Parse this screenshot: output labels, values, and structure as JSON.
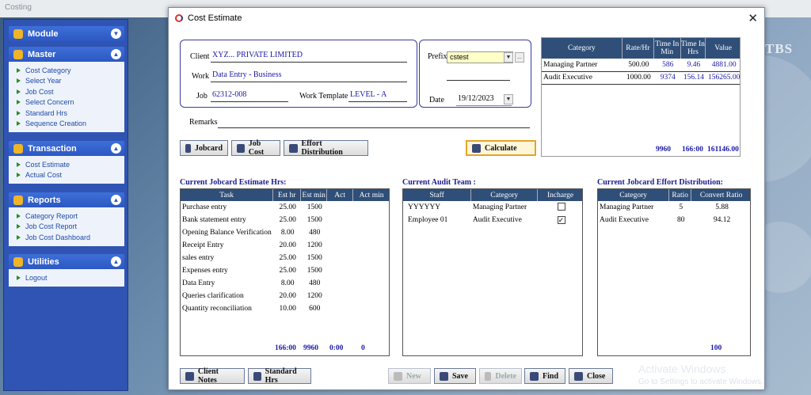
{
  "app": {
    "title": "Costing"
  },
  "sidebar": {
    "panels": [
      {
        "title": "Module",
        "items": []
      },
      {
        "title": "Master",
        "items": [
          "Cost Category",
          "Select Year",
          "Job Cost",
          "Select Concern",
          "Standard Hrs",
          "Sequence Creation"
        ]
      },
      {
        "title": "Transaction",
        "items": [
          "Cost Estimate",
          "Actual Cost"
        ]
      },
      {
        "title": "Reports",
        "items": [
          "Category Report",
          "Job Cost Report",
          "Job Cost Dashboard"
        ]
      },
      {
        "title": "Utilities",
        "items": [
          "Logout"
        ]
      }
    ]
  },
  "background": {
    "logo_text": "TBS"
  },
  "dialog": {
    "title": "Cost Estimate",
    "close_glyph": "✕",
    "form": {
      "client_label": "Client",
      "client_value": "XYZ... PRIVATE LIMITED",
      "work_label": "Work",
      "work_value": "Data Entry - Business",
      "job_label": "Job",
      "job_value": "62312-008",
      "work_template_label": "Work Template",
      "work_template_value": "LEVEL - A",
      "prefix_label": "Prefix",
      "prefix_value": "cstest",
      "date_label": "Date",
      "date_value": "19/12/2023",
      "remarks_label": "Remarks",
      "remarks_value": ""
    },
    "buttons": {
      "jobcard": "Jobcard",
      "job_cost": "Job Cost",
      "effort_distribution": "Effort Distribution",
      "calculate": "Calculate",
      "client_notes": "Client Notes",
      "standard_hrs": "Standard Hrs",
      "new": "New",
      "save": "Save",
      "delete": "Delete",
      "find": "Find",
      "close": "Close"
    },
    "category_table": {
      "headers": [
        "Category",
        "Rate/Hr",
        "Time In Min",
        "Time In Hrs",
        "Value"
      ],
      "rows": [
        [
          "Managing Partner",
          "500.00",
          "586",
          "9.46",
          "4881.00"
        ],
        [
          "Audit Executive",
          "1000.00",
          "9374",
          "156.14",
          "156265.00"
        ]
      ],
      "totals": {
        "min": "9960",
        "hrs": "166:00",
        "value": "161146.00"
      }
    },
    "estimate": {
      "title": "Current Jobcard Estimate Hrs:",
      "headers": [
        "Task",
        "Est hr",
        "Est min",
        "Act",
        "Act min"
      ],
      "rows": [
        [
          "Purchase entry",
          "25.00",
          "1500"
        ],
        [
          "Bank statement entry",
          "25.00",
          "1500"
        ],
        [
          "Opening Balance Verification",
          "8.00",
          "480"
        ],
        [
          "Receipt Entry",
          "20.00",
          "1200"
        ],
        [
          "sales entry",
          "25.00",
          "1500"
        ],
        [
          "Expenses entry",
          "25.00",
          "1500"
        ],
        [
          "Data Entry",
          "8.00",
          "480"
        ],
        [
          "Queries clarification",
          "20.00",
          "1200"
        ],
        [
          "Quantity reconciliation",
          "10.00",
          "600"
        ]
      ],
      "totals": {
        "est_hr": "166:00",
        "est_min": "9960",
        "act": "0:00",
        "act_min": "0"
      }
    },
    "audit_team": {
      "title": "Current Audit Team :",
      "headers": [
        "Staff",
        "Category",
        "Incharge"
      ],
      "rows": [
        {
          "staff": "YYYYYY",
          "category": "Managing Partner",
          "incharge": false,
          "check": ""
        },
        {
          "staff": "Employee 01",
          "category": "Audit Executive",
          "incharge": true,
          "check": "✓"
        }
      ]
    },
    "effort": {
      "title": "Current Jobcard Effort Distribution:",
      "headers": [
        "Category",
        "Ratio",
        "Convert Ratio"
      ],
      "rows": [
        [
          "Managing Partner",
          "5",
          "5.88"
        ],
        [
          "Audit Executive",
          "80",
          "94.12"
        ]
      ],
      "total": "100"
    }
  },
  "watermark": {
    "line1": "Activate Windows",
    "line2": "Go to Settings to activate Windows."
  }
}
